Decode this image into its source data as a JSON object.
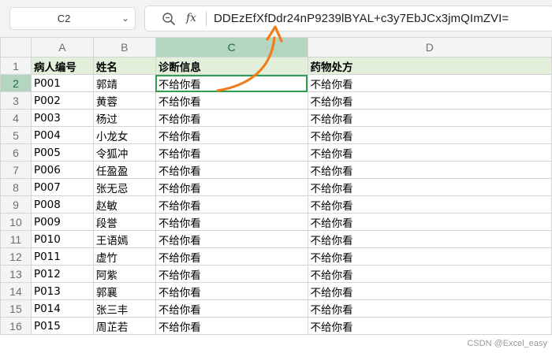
{
  "name_box": {
    "value": "C2"
  },
  "formula_bar": {
    "fx_label": "fx",
    "content": "DDEzEfXfDdr24nP9239lBYAL+c3y7EbJCx3jmQImZVI="
  },
  "columns": [
    "A",
    "B",
    "C",
    "D"
  ],
  "selected_column": "C",
  "selected_row": "2",
  "header": [
    "病人编号",
    "姓名",
    "诊断信息",
    "药物处方"
  ],
  "rows": [
    {
      "n": "2",
      "id": "P001",
      "name": "郭靖",
      "diag": "不给你看",
      "rx": "不给你看"
    },
    {
      "n": "3",
      "id": "P002",
      "name": "黄蓉",
      "diag": "不给你看",
      "rx": "不给你看"
    },
    {
      "n": "4",
      "id": "P003",
      "name": "杨过",
      "diag": "不给你看",
      "rx": "不给你看"
    },
    {
      "n": "5",
      "id": "P004",
      "name": "小龙女",
      "diag": "不给你看",
      "rx": "不给你看"
    },
    {
      "n": "6",
      "id": "P005",
      "name": "令狐冲",
      "diag": "不给你看",
      "rx": "不给你看"
    },
    {
      "n": "7",
      "id": "P006",
      "name": "任盈盈",
      "diag": "不给你看",
      "rx": "不给你看"
    },
    {
      "n": "8",
      "id": "P007",
      "name": "张无忌",
      "diag": "不给你看",
      "rx": "不给你看"
    },
    {
      "n": "9",
      "id": "P008",
      "name": "赵敏",
      "diag": "不给你看",
      "rx": "不给你看"
    },
    {
      "n": "10",
      "id": "P009",
      "name": "段誉",
      "diag": "不给你看",
      "rx": "不给你看"
    },
    {
      "n": "11",
      "id": "P010",
      "name": "王语嫣",
      "diag": "不给你看",
      "rx": "不给你看"
    },
    {
      "n": "12",
      "id": "P011",
      "name": "虚竹",
      "diag": "不给你看",
      "rx": "不给你看"
    },
    {
      "n": "13",
      "id": "P012",
      "name": "阿紫",
      "diag": "不给你看",
      "rx": "不给你看"
    },
    {
      "n": "14",
      "id": "P013",
      "name": "郭襄",
      "diag": "不给你看",
      "rx": "不给你看"
    },
    {
      "n": "15",
      "id": "P014",
      "name": "张三丰",
      "diag": "不给你看",
      "rx": "不给你看"
    },
    {
      "n": "16",
      "id": "P015",
      "name": "周芷若",
      "diag": "不给你看",
      "rx": "不给你看"
    }
  ],
  "watermark": "CSDN @Excel_easy",
  "colors": {
    "accent": "#2f9e4f",
    "header_fill": "#e2efda",
    "arrow": "#f07c1a"
  },
  "icons": {
    "zoom": "zoom-icon",
    "dropdown": "chevron-down-icon"
  }
}
